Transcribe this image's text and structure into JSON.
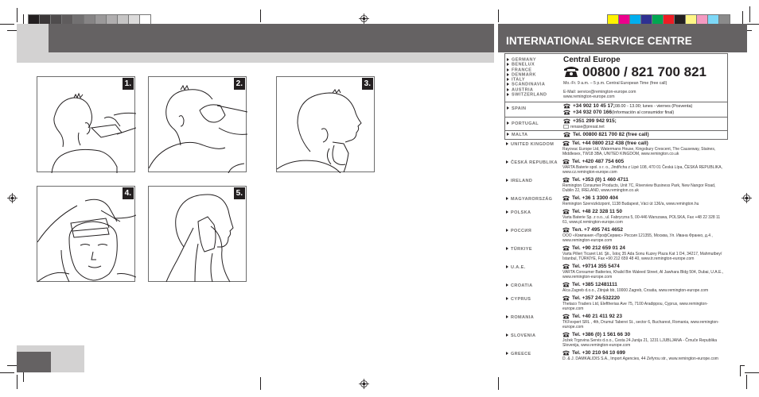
{
  "header": {
    "title": "INTERNATIONAL SERVICE CENTRE",
    "gray_swatches": [
      "#231f20",
      "#3b3738",
      "#4f4c4d",
      "#5f5c5d",
      "#727071",
      "#868485",
      "#9b999a",
      "#b0aeaf",
      "#c6c5c5",
      "#dcdbdb",
      "#ffffff"
    ],
    "color_swatches": [
      "#fff200",
      "#ec008c",
      "#00aeef",
      "#2e3192",
      "#00a651",
      "#ed1c24",
      "#231f20",
      "#fff685",
      "#f49ac1",
      "#7dd8f7",
      "#8a8a8a"
    ],
    "brand_dark": "#656263",
    "brand_light": "#d3d2d2"
  },
  "steps": [
    {
      "number": "1.",
      "description": "clipping hair at back of neck"
    },
    {
      "number": "2.",
      "description": "clipping hair above ear"
    },
    {
      "number": "3.",
      "description": "trimming sideburn, side profile"
    },
    {
      "number": "4.",
      "description": "clipping top of head with comb attachment"
    },
    {
      "number": "5.",
      "description": "trimming side with both hands"
    }
  ],
  "service": {
    "central_europe": {
      "countries": [
        "GERMANY",
        "BENELUX",
        "FRANCE",
        "DENMARK",
        "ITALY",
        "SCANDINAVIA",
        "AUSTRIA",
        "SWITZERLAND"
      ],
      "title": "Central Europe",
      "phone": "00800 / 821 700 821",
      "hours": "Mo.-Fr. 9 a.m. – 5 p.m. Central European Time (free call)",
      "email": "E-Mail: service@remington-europe.com",
      "web": "www.remington-europe.com"
    },
    "spain": {
      "country": "SPAIN",
      "tel1": "+34 902 10 45 17;",
      "tel1_note": " 08.00 - 13.00; lunes - viernes (Posventa)",
      "tel2": "+34 932 070 166",
      "tel2_note": " (Información al consumidor final)"
    },
    "portugal": {
      "country": "PORTUGAL",
      "tel": "+351 299 942 915;",
      "email": "renase@presat.net"
    },
    "malta": {
      "country": "MALTA",
      "tel": "Tel. 00800 821 700 82 (free call)"
    },
    "entries": [
      {
        "country": "UNITED KINGDOM",
        "tel": "Tel. +44 0800 212 438 (free call)",
        "address": "Rayovac Europe Ltd, Watermans House, Kingsbury Crescent, The Causeway, Staines, Middlesex, TW18 3BA, UNITED KINGDOM, www.remington.co.uk"
      },
      {
        "country": "ČESKÁ REPUBLIKA",
        "tel": "Tel. +420 487 754 605",
        "address": "VARTA Baterie spol. s r. o., Jindřicha z Lipé 108, 470 01 Česká Lípa, ČESKÁ REPUBLIKA, www.cz.remington-europe.com"
      },
      {
        "country": "IRELAND",
        "tel": "Tel. +353 (0) 1 460 4711",
        "address": "Remington Consumer Products, Unit 7C, Riverview Business Park, New Nangor Road, Dublin 22, IRELAND, www.remington.co.uk"
      },
      {
        "country": "MAGYARORSZÁG",
        "tel": "Tel. +36 1 3300 404",
        "address": "Remington Szervizközpont, 1138 Budapest, Váci út 136/a, www.remington.hu"
      },
      {
        "country": "POLSKA",
        "tel": "Tel. +48 22 328 11 50",
        "address": "Varta Baterie Sp. z o.o., ul. Fabryczna 5, 00-446 Warszawa, POLSKA, Fax +48 22 328 11 61, www.pl.remington-europe.com"
      },
      {
        "country": "РОССИЯ",
        "tel": "Тел. +7 495 741 4652",
        "address": "ООО «Компания «ПрофСервис» Россия 121355, Москва, Ул. Ивана Франко, д.4 , www.remington-europe.com"
      },
      {
        "country": "TÜRKIYE",
        "tel": "Tel. +90 212 659 01 24",
        "address": "Varta Pilleri Ticaret Ltd. Şti., İstoç 35 Ada Sonu Kuzey Plaza Kat 1 D4, 34217, Mahmutbey/İstanbul, TÜRKİYE, Fax +90 212 659 48 40, www.tr.remington-europe.com"
      },
      {
        "country": "U.A.E.",
        "tel": "Tel. +9714 355 5474",
        "address": "VARTA Consumer Batteries, Khalid Bin Waleed Street, Al Jawhara Bldg 504, Dubai, U.A.E., www.remington-europe.com"
      },
      {
        "country": "CROATIA",
        "tel": "Tel. +385 12481111",
        "address": "Alca Zagreb d.o.o., Zitnjak bb, 10000 Zagreb, Croatia, www.remington-europe.com"
      },
      {
        "country": "CYPRUS",
        "tel": "Tel. +357 24-532220",
        "address": "Thetaco Traders Ltd, Eleftherias Ave 75, 7100 Aradippou, Cyprus, www.remington-europe.com"
      },
      {
        "country": "ROMANIA",
        "tel": "Tel. +40 21 411 92 23",
        "address": "TKFexpert SRL , 4th, Drumul Taberei St., sector 6, Bucharest, Romania, www.remington-europe.com"
      },
      {
        "country": "SLOVENIA",
        "tel": "Tel. +386 (0) 1 561 66 30",
        "address": "Jožek Trgovina Servis d.o.o., Cesta 24.Junija 21, 1231 LJUBLJANA - Črnuče Republika Slovenija, www.remington-europe.com"
      },
      {
        "country": "GREECE",
        "tel": "Tel. +30 210 94 10 699",
        "address": "D. & J. DAMKALIDIS S.A., Import Agencies, 44 Zefyrou str., www.remington-europe.com"
      }
    ]
  }
}
